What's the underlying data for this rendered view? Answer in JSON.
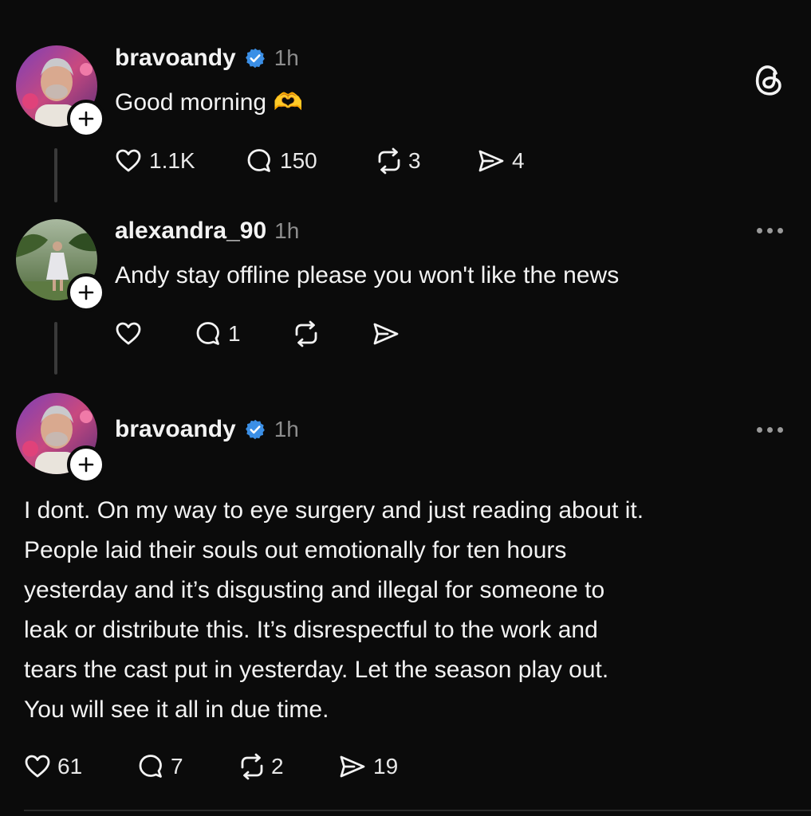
{
  "posts": [
    {
      "username": "bravoandy",
      "verified": true,
      "time": "1h",
      "text": "Good morning 🫶",
      "likes": "1.1K",
      "replies": "150",
      "reposts": "3",
      "shares": "4"
    },
    {
      "username": "alexandra_90",
      "verified": false,
      "time": "1h",
      "text": "Andy stay offline please you won't like the news",
      "likes": "",
      "replies": "1",
      "reposts": "",
      "shares": ""
    },
    {
      "username": "bravoandy",
      "verified": true,
      "time": "1h",
      "text_lines": [
        "I dont. On my way to eye surgery and just reading about it.",
        "People laid their souls out emotionally for ten hours",
        "yesterday and it’s disgusting and illegal for someone to",
        "leak or distribute this. It’s disrespectful to the work and",
        "tears the cast put in yesterday. Let the season play out.",
        "You will see it all in due time."
      ],
      "likes": "61",
      "replies": "7",
      "reposts": "2",
      "shares": "19"
    }
  ],
  "colors": {
    "background": "#0b0b0b",
    "text": "#f3f3f3",
    "muted": "#8e8e8e",
    "verified_blue": "#3b8fe6"
  },
  "icons": {
    "logo": "threads-logo-icon",
    "like": "heart-icon",
    "reply": "comment-icon",
    "repost": "repost-icon",
    "share": "send-icon",
    "more": "more-dots-icon",
    "follow": "plus-icon",
    "verified": "verified-badge-icon"
  }
}
